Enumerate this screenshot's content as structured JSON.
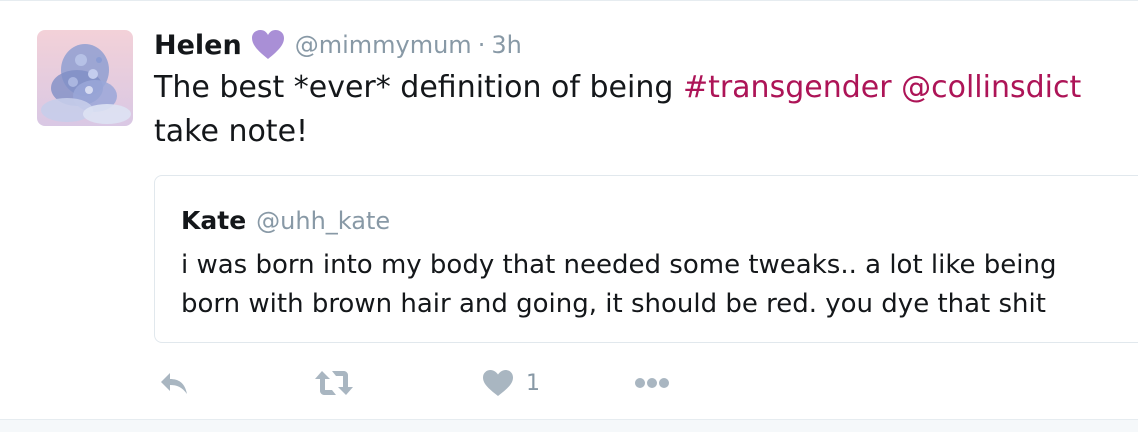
{
  "tweet": {
    "author": {
      "display_name": "Helen",
      "name_emoji": "purple-heart-icon",
      "handle": "@mimmymum",
      "separator": "·",
      "time": "3h"
    },
    "text_before": "The best *ever* definition of being ",
    "hashtag": "#transgender",
    "space": " ",
    "mention": "@collinsdict",
    "text_after": " take note!",
    "quoted": {
      "display_name": "Kate",
      "handle": "@uhh_kate",
      "text": "i was born into my body that needed some tweaks.. a lot like being born with brown hair and going, it should be red. you dye that shit"
    },
    "actions": {
      "reply_icon": "reply-icon",
      "retweet_icon": "retweet-icon",
      "like_icon": "heart-icon",
      "like_count": "1",
      "more_icon": "more-icon"
    }
  },
  "colors": {
    "link": "#ad1457",
    "muted": "#8899a6",
    "icon": "#a9b6c1",
    "emoji_heart": "#a98fd6"
  }
}
